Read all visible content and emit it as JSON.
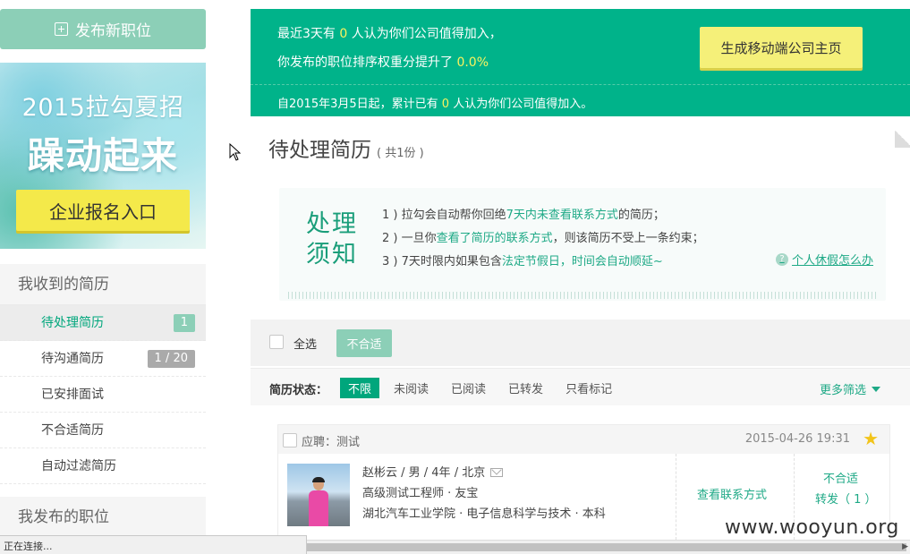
{
  "sidebar": {
    "post_job_label": "发布新职位",
    "banner": {
      "year_title": "2015拉勾夏招",
      "slogan": "躁动起来",
      "button_label": "企业报名入口"
    },
    "resume_section_title": "我收到的简历",
    "items": [
      {
        "label": "待处理简历",
        "badge": "1",
        "active": true
      },
      {
        "label": "待沟通简历",
        "badge": "1 / 20",
        "active": false
      },
      {
        "label": "已安排面试",
        "badge": "",
        "active": false
      },
      {
        "label": "不合适简历",
        "badge": "",
        "active": false
      },
      {
        "label": "自动过滤简历",
        "badge": "",
        "active": false
      }
    ],
    "jobs_section_title": "我发布的职位"
  },
  "topbar": {
    "line1_prefix": "最近3天有",
    "line1_count": "0",
    "line1_suffix": "人认为你们公司值得加入，",
    "line2_prefix": "你发布的职位排序权重分提升了",
    "line2_value": "0.0%",
    "since_prefix": "自2015年3月5日起，累计已有",
    "since_count": "0",
    "since_suffix": "人认为你们公司值得加入。",
    "mobile_button": "生成移动端公司主页"
  },
  "page": {
    "title": "待处理简历",
    "count": "( 共1份 )"
  },
  "notice": {
    "seal_line1": "处理",
    "seal_line2": "须知",
    "item1_a": "1 ) 拉勾会自动帮你回绝",
    "item1_link": "7天内未查看联系方式",
    "item1_b": "的简历；",
    "item2_a": "2 ) 一旦你",
    "item2_link": "查看了简历的联系方式",
    "item2_b": "，则该简历不受上一条约束；",
    "item3_a": "3 ) 7天时限内如果包含",
    "item3_link": "法定节假日，时间会自动顺延~",
    "help_link": "个人休假怎么办"
  },
  "toolbar": {
    "select_all": "全选",
    "unfit_button": "不合适"
  },
  "filter": {
    "label": "简历状态：",
    "options": [
      "不限",
      "未阅读",
      "已阅读",
      "已转发",
      "只看标记"
    ],
    "selected": "不限",
    "more": "更多筛选"
  },
  "resume": {
    "apply_for": "应聘：测试",
    "date": "2015-04-26 19:31",
    "summary": "赵彬云 / 男 / 4年 / 北京",
    "position": "高级测试工程师 · 友宝",
    "education": "湖北汽车工业学院 · 电子信息科学与技术 · 本科",
    "view_contact": "查看联系方式",
    "unfit": "不合适",
    "forward": "转发（ 1 ）"
  },
  "status_bar": {
    "text": "正在连接..."
  },
  "watermark": "www.wooyun.org",
  "colors": {
    "brand_green": "#00b38a",
    "accent_yellow": "#f9f35f",
    "mint": "#8ccfb7"
  }
}
